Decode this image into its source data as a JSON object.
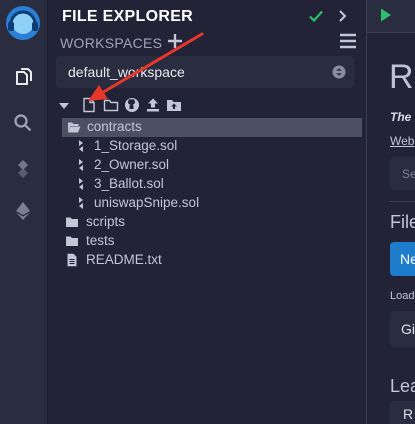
{
  "sidebar_icons": [
    "remix-logo-icon",
    "file-explorer-icon",
    "search-icon",
    "solidity-compiler-icon",
    "deploy-run-icon"
  ],
  "explorer": {
    "title": "FILE EXPLORER",
    "workspaces_label": "WORKSPACES",
    "selected_workspace": "default_workspace"
  },
  "file_tree": {
    "contracts": "contracts",
    "files": [
      "1_Storage.sol",
      "2_Owner.sol",
      "3_Ballot.sol",
      "uniswapSnipe.sol"
    ],
    "scripts": "scripts",
    "tests": "tests",
    "readme": "README.txt"
  },
  "home": {
    "big_title": "Re",
    "italic": "The",
    "link": "Web",
    "search_placeholder": "Se",
    "files_heading": "File",
    "new_button": "Ne",
    "load_label": "Load",
    "git_button": "Gi",
    "learn_heading": "Lea",
    "re_button": "R"
  },
  "colors": {
    "accent_green": "#2ebd6a",
    "primary_blue": "#1e7ccc",
    "annotation_red": "#e8362b"
  }
}
